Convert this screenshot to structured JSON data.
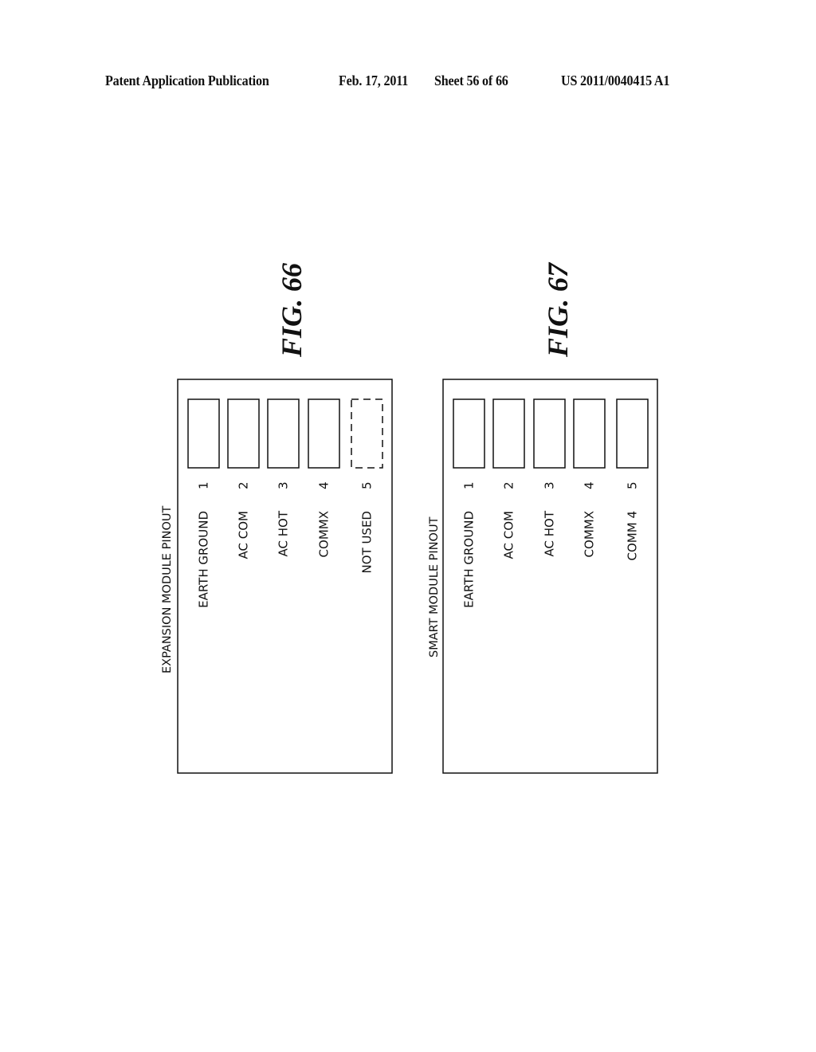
{
  "header": {
    "publication": "Patent Application Publication",
    "date": "Feb. 17, 2011",
    "sheet": "Sheet 56 of 66",
    "number": "US 2011/0040415 A1"
  },
  "figures": [
    {
      "id": "fig66",
      "label": "FIG. 66",
      "title": "EXPANSION MODULE PINOUT",
      "pins": [
        {
          "number": "1",
          "name": "EARTH GROUND",
          "style": "solid"
        },
        {
          "number": "2",
          "name": "AC COM",
          "style": "solid"
        },
        {
          "number": "3",
          "name": "AC HOT",
          "style": "solid"
        },
        {
          "number": "4",
          "name": "COMMX",
          "style": "solid"
        },
        {
          "number": "5",
          "name": "NOT USED",
          "style": "dashed"
        }
      ]
    },
    {
      "id": "fig67",
      "label": "FIG. 67",
      "title": "SMART MODULE PINOUT",
      "pins": [
        {
          "number": "1",
          "name": "EARTH GROUND",
          "style": "solid"
        },
        {
          "number": "2",
          "name": "AC COM",
          "style": "solid"
        },
        {
          "number": "3",
          "name": "AC HOT",
          "style": "solid"
        },
        {
          "number": "4",
          "name": "COMMX",
          "style": "solid"
        },
        {
          "number": "5",
          "name": "COMM 4",
          "style": "solid"
        }
      ]
    }
  ]
}
